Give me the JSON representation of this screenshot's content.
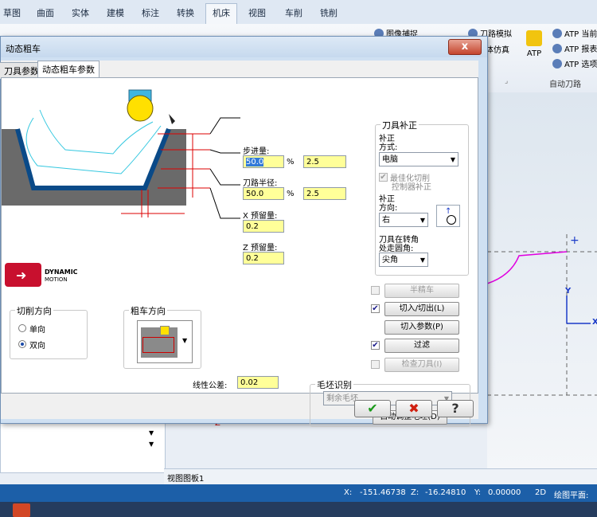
{
  "ribbon": {
    "tabs": [
      "草图",
      "曲面",
      "实体",
      "建模",
      "标注",
      "转换",
      "机床",
      "视图",
      "车削",
      "铣削"
    ],
    "active_tab": "机床",
    "toolpath_sim": "刀路模拟",
    "solid_sim": "实体仿真",
    "image_capture": "图像捕捉",
    "atp_label": "ATP",
    "atp_items": [
      "ATP 当前",
      "ATP 报表",
      "ATP 选项"
    ],
    "group_auto_toolpath": "自动刀路"
  },
  "dialog": {
    "title": "动态粗车",
    "close": "x",
    "tabs": [
      "刀具参数",
      "动态粗车参数"
    ],
    "step": {
      "label": "步进量:",
      "value_pct": "50.0",
      "unit": "%",
      "value_mm": "2.5"
    },
    "path_radius": {
      "label": "刀路半径:",
      "value_pct": "50.0",
      "unit": "%",
      "value_mm": "2.5"
    },
    "x_stock": {
      "label": "X 预留量:",
      "value": "0.2"
    },
    "z_stock": {
      "label": "Z 预留量:",
      "value": "0.2"
    },
    "logo_text": [
      "DYNAMIC",
      "MOTION"
    ],
    "cut_direction": {
      "title": "切削方向",
      "one_way": "单向",
      "two_way": "双向",
      "selected": "双向"
    },
    "rough_direction": {
      "title": "粗车方向"
    },
    "linear_tolerance": {
      "label": "线性公差:",
      "value": "0.02"
    },
    "tool_comp": {
      "title": "刀具补正",
      "comp_type_label": [
        "补正",
        "方式:"
      ],
      "comp_type_value": "电脑",
      "optimize_label": [
        "最佳化切削",
        "控制器补正"
      ],
      "comp_dir_label": [
        "补正",
        "方向:"
      ],
      "comp_dir_value": "右",
      "corner_label": [
        "刀具在转角",
        "处走圆角:"
      ],
      "corner_value": "尖角"
    },
    "semi_finish": {
      "label": "半精车",
      "checked": false,
      "enabled": false
    },
    "lead_in_out": {
      "label": "切入/切出(L)",
      "checked": true
    },
    "plunge_params": {
      "label": "切入参数(P)"
    },
    "filter": {
      "label": "过滤",
      "checked": true
    },
    "check_tool": {
      "label": "检查刀具(I)",
      "checked": false,
      "enabled": false
    },
    "stock_recognition": {
      "title": "毛坯识别",
      "value": "剩余毛坯",
      "auto_adjust": "自动调整毛坯(D)"
    },
    "ok_icon": "✔",
    "cancel_icon": "✖",
    "help_icon": "?"
  },
  "graphics": {
    "y_axis": "Y",
    "x_axis": "X",
    "z_marker": "Z"
  },
  "viewsheet_tab": "视图图板1",
  "status": {
    "x_label": "X:",
    "x": "-151.46738",
    "z_label": "Z:",
    "z": "-16.24810",
    "y_label": "Y:",
    "y": "0.00000",
    "mode": "2D",
    "plane": "绘图平面: 未"
  }
}
